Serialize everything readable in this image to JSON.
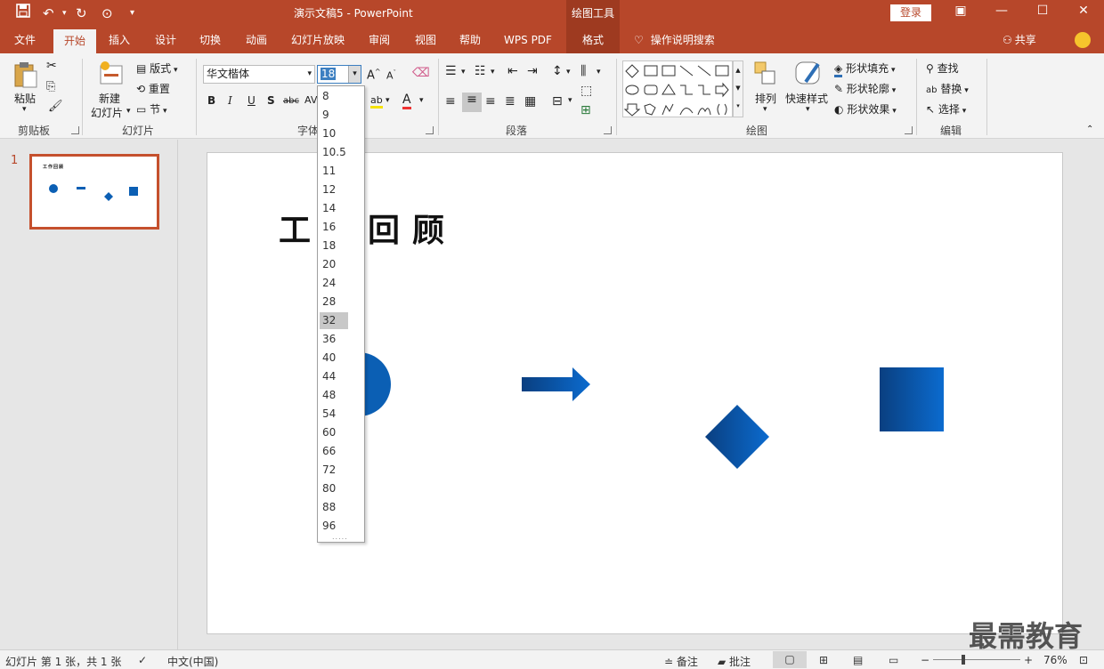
{
  "titlebar": {
    "title": "演示文稿5  -  PowerPoint",
    "context_group": "绘图工具",
    "login": "登录"
  },
  "tabs": [
    "文件",
    "开始",
    "插入",
    "设计",
    "切换",
    "动画",
    "幻灯片放映",
    "审阅",
    "视图",
    "帮助",
    "WPS PDF",
    "格式"
  ],
  "tell_me": "操作说明搜索",
  "share": "共享",
  "ribbon": {
    "clipboard": {
      "paste": "粘贴",
      "label": "剪贴板"
    },
    "slides": {
      "new_line1": "新建",
      "new_line2": "幻灯片",
      "layout": "版式",
      "reset": "重置",
      "section": "节",
      "label": "幻灯片"
    },
    "font": {
      "name": "华文楷体",
      "size": "18",
      "label": "字体"
    },
    "paragraph": {
      "label": "段落"
    },
    "drawing": {
      "arrange": "排列",
      "quick_styles": "快速样式",
      "fill": "形状填充",
      "outline": "形状轮廓",
      "effects": "形状效果",
      "label": "绘图"
    },
    "editing": {
      "find": "查找",
      "replace": "替换",
      "select": "选择",
      "label": "编辑"
    }
  },
  "font_sizes": [
    "8",
    "9",
    "10",
    "10.5",
    "11",
    "12",
    "14",
    "16",
    "18",
    "20",
    "24",
    "28",
    "32",
    "36",
    "40",
    "44",
    "48",
    "54",
    "60",
    "66",
    "72",
    "80",
    "88",
    "96"
  ],
  "font_size_highlighted": "32",
  "thumbnail": {
    "number": "1"
  },
  "slide": {
    "title": "工作回顾"
  },
  "statusbar": {
    "slide_info": "幻灯片 第 1 张，共 1 张",
    "language": "中文(中国)",
    "notes": "备注",
    "comments": "批注",
    "zoom": "76%"
  },
  "watermark": "最需教育",
  "colors": {
    "accent": "#b7472a",
    "shape_blue": "#0b5fb4"
  }
}
